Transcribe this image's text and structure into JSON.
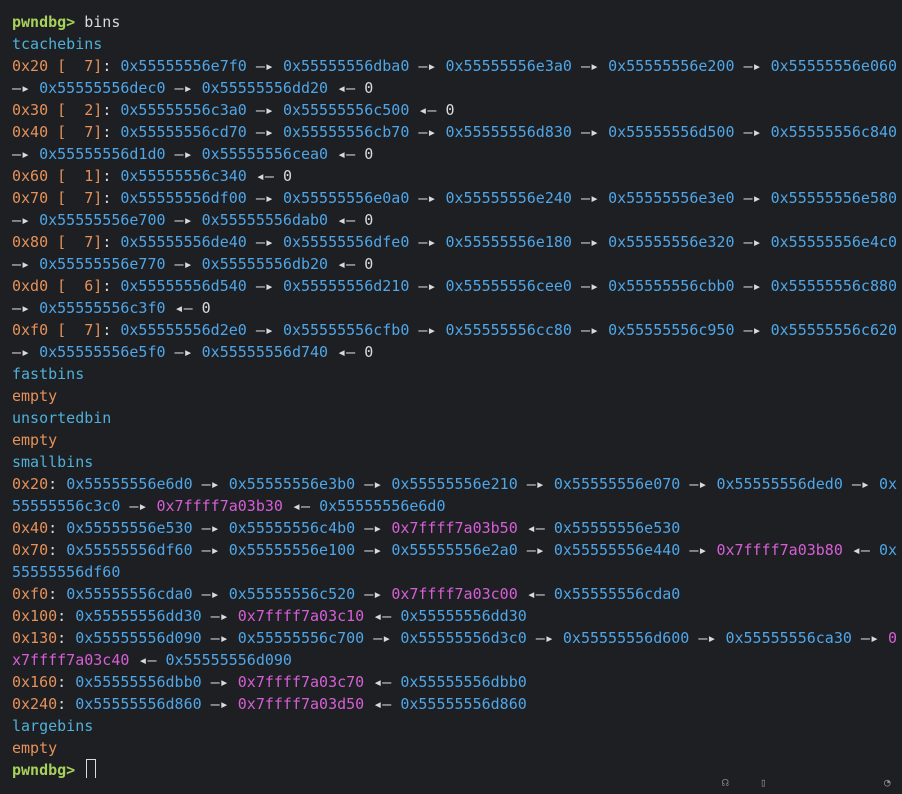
{
  "prompt": "pwndbg>",
  "command": "bins",
  "tcache_label": "tcachebins",
  "fastbins_label": "fastbins",
  "unsortedbin_label": "unsortedbin",
  "smallbins_label": "smallbins",
  "largebins_label": "largebins",
  "empty_text": "empty",
  "tcache": [
    {
      "size": "0x20",
      "count": "7",
      "lines": [
        [
          "0x55555556e7f0",
          "0x55555556dba0",
          "0x55555556e3a0",
          "0x55555556e200",
          "0x55555556e060"
        ],
        [
          "0x55555556dec0",
          "0x55555556dd20"
        ]
      ],
      "terminator": "0"
    },
    {
      "size": "0x30",
      "count": "2",
      "lines": [
        [
          "0x55555556c3a0",
          "0x55555556c500"
        ]
      ],
      "terminator": "0"
    },
    {
      "size": "0x40",
      "count": "7",
      "lines": [
        [
          "0x55555556cd70",
          "0x55555556cb70",
          "0x55555556d830",
          "0x55555556d500",
          "0x55555556c840"
        ],
        [
          "0x55555556d1d0",
          "0x55555556cea0"
        ]
      ],
      "terminator": "0"
    },
    {
      "size": "0x60",
      "count": "1",
      "lines": [
        [
          "0x55555556c340"
        ]
      ],
      "terminator": "0"
    },
    {
      "size": "0x70",
      "count": "7",
      "lines": [
        [
          "0x55555556df00",
          "0x55555556e0a0",
          "0x55555556e240",
          "0x55555556e3e0",
          "0x55555556e580"
        ],
        [
          "0x55555556e700",
          "0x55555556dab0"
        ]
      ],
      "terminator": "0"
    },
    {
      "size": "0x80",
      "count": "7",
      "lines": [
        [
          "0x55555556de40",
          "0x55555556dfe0",
          "0x55555556e180",
          "0x55555556e320",
          "0x55555556e4c0"
        ],
        [
          "0x55555556e770",
          "0x55555556db20"
        ]
      ],
      "terminator": "0"
    },
    {
      "size": "0xd0",
      "count": "6",
      "lines": [
        [
          "0x55555556d540",
          "0x55555556d210",
          "0x55555556cee0",
          "0x55555556cbb0",
          "0x55555556c880"
        ],
        [
          "0x55555556c3f0"
        ]
      ],
      "terminator": "0"
    },
    {
      "size": "0xf0",
      "count": "7",
      "lines": [
        [
          "0x55555556d2e0",
          "0x55555556cfb0",
          "0x55555556cc80",
          "0x55555556c950",
          "0x55555556c620"
        ],
        [
          "0x55555556e5f0",
          "0x55555556d740"
        ]
      ],
      "terminator": "0"
    }
  ],
  "smallbins_rows": [
    [
      {
        "t": "0x20",
        "c": "orn"
      },
      {
        "t": ": ",
        "c": "wht"
      },
      {
        "t": "0x55555556e6d0",
        "c": "blu"
      },
      {
        "t": " —▸ ",
        "c": "wht"
      },
      {
        "t": "0x55555556e3b0",
        "c": "blu"
      },
      {
        "t": " —▸ ",
        "c": "wht"
      },
      {
        "t": "0x55555556e210",
        "c": "blu"
      },
      {
        "t": " —▸ ",
        "c": "wht"
      },
      {
        "t": "0x55555556e070",
        "c": "blu"
      },
      {
        "t": " —▸ ",
        "c": "wht"
      },
      {
        "t": "0x55555556ded0",
        "c": "blu"
      },
      {
        "t": " —▸ ",
        "c": "wht"
      },
      {
        "t": "0x",
        "c": "blu"
      }
    ],
    [
      {
        "t": "55555556c3c0",
        "c": "blu"
      },
      {
        "t": " —▸ ",
        "c": "wht"
      },
      {
        "t": "0x7ffff7a03b30",
        "c": "mag"
      },
      {
        "t": " ◂— ",
        "c": "wht"
      },
      {
        "t": "0x55555556e6d0",
        "c": "blu"
      }
    ],
    [
      {
        "t": "0x40",
        "c": "orn"
      },
      {
        "t": ": ",
        "c": "wht"
      },
      {
        "t": "0x55555556e530",
        "c": "blu"
      },
      {
        "t": " —▸ ",
        "c": "wht"
      },
      {
        "t": "0x55555556c4b0",
        "c": "blu"
      },
      {
        "t": " —▸ ",
        "c": "wht"
      },
      {
        "t": "0x7ffff7a03b50",
        "c": "mag"
      },
      {
        "t": " ◂— ",
        "c": "wht"
      },
      {
        "t": "0x55555556e530",
        "c": "blu"
      }
    ],
    [
      {
        "t": "0x70",
        "c": "orn"
      },
      {
        "t": ": ",
        "c": "wht"
      },
      {
        "t": "0x55555556df60",
        "c": "blu"
      },
      {
        "t": " —▸ ",
        "c": "wht"
      },
      {
        "t": "0x55555556e100",
        "c": "blu"
      },
      {
        "t": " —▸ ",
        "c": "wht"
      },
      {
        "t": "0x55555556e2a0",
        "c": "blu"
      },
      {
        "t": " —▸ ",
        "c": "wht"
      },
      {
        "t": "0x55555556e440",
        "c": "blu"
      },
      {
        "t": " —▸ ",
        "c": "wht"
      },
      {
        "t": "0x7ffff7a03b80",
        "c": "mag"
      },
      {
        "t": " ◂— ",
        "c": "wht"
      },
      {
        "t": "0x",
        "c": "blu"
      }
    ],
    [
      {
        "t": "55555556df60",
        "c": "blu"
      }
    ],
    [
      {
        "t": "0xf0",
        "c": "orn"
      },
      {
        "t": ": ",
        "c": "wht"
      },
      {
        "t": "0x55555556cda0",
        "c": "blu"
      },
      {
        "t": " —▸ ",
        "c": "wht"
      },
      {
        "t": "0x55555556c520",
        "c": "blu"
      },
      {
        "t": " —▸ ",
        "c": "wht"
      },
      {
        "t": "0x7ffff7a03c00",
        "c": "mag"
      },
      {
        "t": " ◂— ",
        "c": "wht"
      },
      {
        "t": "0x55555556cda0",
        "c": "blu"
      }
    ],
    [
      {
        "t": "0x100",
        "c": "orn"
      },
      {
        "t": ": ",
        "c": "wht"
      },
      {
        "t": "0x55555556dd30",
        "c": "blu"
      },
      {
        "t": " —▸ ",
        "c": "wht"
      },
      {
        "t": "0x7ffff7a03c10",
        "c": "mag"
      },
      {
        "t": " ◂— ",
        "c": "wht"
      },
      {
        "t": "0x55555556dd30",
        "c": "blu"
      }
    ],
    [
      {
        "t": "0x130",
        "c": "orn"
      },
      {
        "t": ": ",
        "c": "wht"
      },
      {
        "t": "0x55555556d090",
        "c": "blu"
      },
      {
        "t": " —▸ ",
        "c": "wht"
      },
      {
        "t": "0x55555556c700",
        "c": "blu"
      },
      {
        "t": " —▸ ",
        "c": "wht"
      },
      {
        "t": "0x55555556d3c0",
        "c": "blu"
      },
      {
        "t": " —▸ ",
        "c": "wht"
      },
      {
        "t": "0x55555556d600",
        "c": "blu"
      },
      {
        "t": " —▸ ",
        "c": "wht"
      },
      {
        "t": "0x55555556ca30",
        "c": "blu"
      },
      {
        "t": " —▸ ",
        "c": "wht"
      },
      {
        "t": "0",
        "c": "mag"
      }
    ],
    [
      {
        "t": "x7ffff7a03c40",
        "c": "mag"
      },
      {
        "t": " ◂— ",
        "c": "wht"
      },
      {
        "t": "0x55555556d090",
        "c": "blu"
      }
    ],
    [
      {
        "t": "0x160",
        "c": "orn"
      },
      {
        "t": ": ",
        "c": "wht"
      },
      {
        "t": "0x55555556dbb0",
        "c": "blu"
      },
      {
        "t": " —▸ ",
        "c": "wht"
      },
      {
        "t": "0x7ffff7a03c70",
        "c": "mag"
      },
      {
        "t": " ◂— ",
        "c": "wht"
      },
      {
        "t": "0x55555556dbb0",
        "c": "blu"
      }
    ],
    [
      {
        "t": "0x240",
        "c": "orn"
      },
      {
        "t": ": ",
        "c": "wht"
      },
      {
        "t": "0x55555556d860",
        "c": "blu"
      },
      {
        "t": " —▸ ",
        "c": "wht"
      },
      {
        "t": "0x7ffff7a03d50",
        "c": "mag"
      },
      {
        "t": " ◂— ",
        "c": "wht"
      },
      {
        "t": "0x55555556d860",
        "c": "blu"
      }
    ]
  ]
}
